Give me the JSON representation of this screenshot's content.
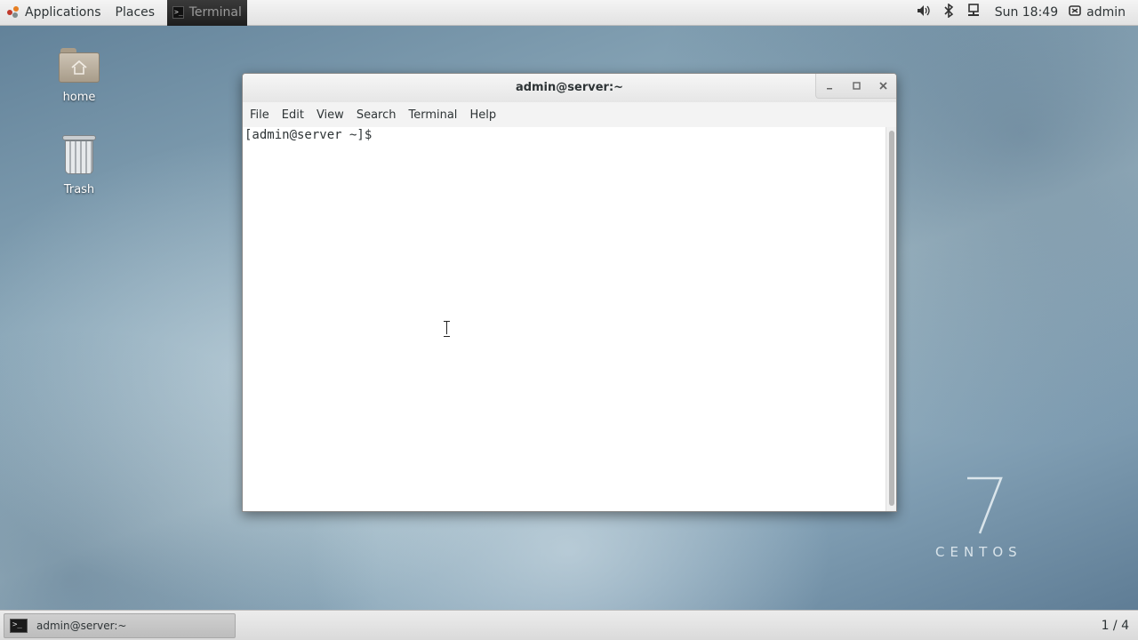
{
  "top_panel": {
    "applications_label": "Applications",
    "places_label": "Places",
    "active_task_label": "Terminal",
    "clock": "Sun 18:49",
    "user": "admin",
    "tray_icons": [
      "volume-icon",
      "bluetooth-icon",
      "network-icon"
    ]
  },
  "desktop": {
    "icons": [
      {
        "label": "home",
        "icon": "home-folder-icon"
      },
      {
        "label": "Trash",
        "icon": "trash-icon"
      }
    ],
    "branding": {
      "number": "7",
      "text": "CENTOS"
    }
  },
  "terminal_window": {
    "title": "admin@server:~",
    "menu": [
      "File",
      "Edit",
      "View",
      "Search",
      "Terminal",
      "Help"
    ],
    "prompt": "[admin@server ~]$"
  },
  "bottom_panel": {
    "task_label": "admin@server:~",
    "workspace": "1 / 4"
  },
  "colors": {
    "panel_bg": "#e6e6e6",
    "terminal_bg": "#ffffff",
    "text": "#2e3436"
  }
}
